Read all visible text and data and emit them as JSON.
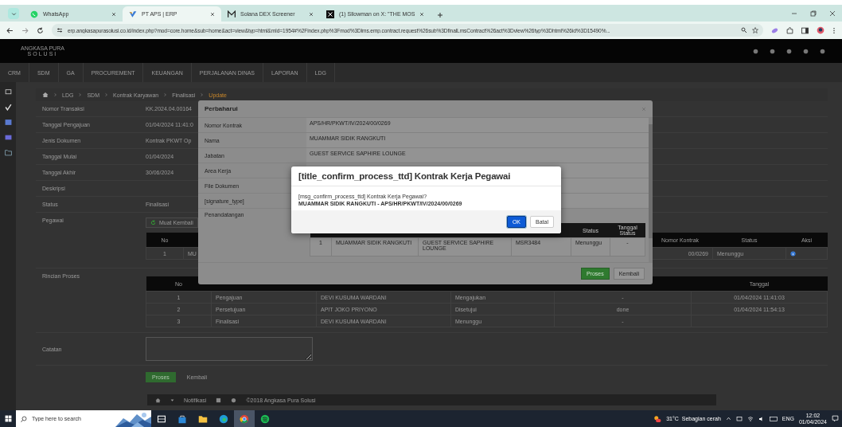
{
  "browser": {
    "tabs": [
      {
        "title": "WhatsApp",
        "kind": "whatsapp",
        "selected": false
      },
      {
        "title": "PT APS | ERP",
        "kind": "erp",
        "selected": true
      },
      {
        "title": "Solana DEX Screener",
        "kind": "m",
        "selected": false
      },
      {
        "title": "(1) Sllowman on X: \"THE MOS",
        "kind": "x",
        "selected": false
      }
    ],
    "url": "erp.angkasapurasolusi.co.id/index.php?mod=core.home&sub=home&act=view&typ=html&mId=1954#%2Findex.php%3Fmod%3Dlms.emp.contract.request%26sub%3DfinalLmsContract%26act%3Dview%26typ%3Dhtml%26id%3D15490%..."
  },
  "app": {
    "logo": {
      "name": "ANGKASA PURA",
      "sub": "SOLUSI"
    },
    "nav": [
      "CRM",
      "SDM",
      "GA",
      "PROCUREMENT",
      "KEUANGAN",
      "PERJALANAN DINAS",
      "LAPORAN",
      "LDG"
    ],
    "breadcrumb": [
      "LDG",
      "SDM",
      "Kontrak Karyawan",
      "Finalisasi",
      "Update"
    ],
    "form": [
      {
        "label": "Nomor Transaksi",
        "value": "KK.2024.04.00164"
      },
      {
        "label": "Tanggal Pengajuan",
        "value": "01/04/2024 11:41:0"
      },
      {
        "label": "Jenis Dokumen",
        "value": "Kontrak PKWT Op"
      },
      {
        "label": "Tanggal Mulai",
        "value": "01/04/2024"
      },
      {
        "label": "Tanggal Akhir",
        "value": "30/06/2024"
      },
      {
        "label": "Deskripsi"
      },
      {
        "label": "Status",
        "value": "Finalisasi"
      }
    ],
    "pegawai": {
      "label": "Pegawai",
      "reload_button": "Muat Kembali",
      "columns": [
        "No",
        "Nomor Kontrak",
        "Status",
        "Aksi"
      ],
      "row": {
        "no": "1",
        "name": "MU",
        "contract": "00/0269",
        "status": "Menunggu"
      }
    },
    "rincian": {
      "label": "Rincian Proses",
      "columns": [
        "No",
        "",
        "",
        "",
        "",
        "Tanggal"
      ],
      "rows": [
        [
          "1",
          "Pengajuan",
          "DEVI KUSUMA WARDANI",
          "Mengajukan",
          "-",
          "01/04/2024 11:41:03"
        ],
        [
          "2",
          "Persetujuan",
          "APIT JOKO PRIYONO",
          "Disetujui",
          "done",
          "01/04/2024 11:54:13"
        ],
        [
          "3",
          "Finalisasi",
          "DEVI KUSUMA WARDANI",
          "Menunggu",
          "-",
          ""
        ]
      ]
    },
    "catatan": {
      "label": "Catatan"
    },
    "buttons": [
      {
        "label": "Proses",
        "kind": "primary"
      },
      {
        "label": "Kembali",
        "kind": "link"
      }
    ],
    "footer": {
      "notification": "Notifikasi",
      "copyright": "©2018 Angkasa Pura Solusi"
    }
  },
  "modal": {
    "title": "Perbaharui",
    "fields": [
      {
        "label": "Nomor Kontrak",
        "value": "APS/HR/PKWT/IV/2024/00/0269"
      },
      {
        "label": "Nama",
        "value": "MUAMMAR SIDIK RANGKUTI"
      },
      {
        "label": "Jabatan",
        "value": "GUEST SERVICE SAPHIRE LOUNGE"
      },
      {
        "label": "Area Kerja"
      },
      {
        "label": "File Dokumen"
      },
      {
        "label": "[signature_type]"
      },
      {
        "label": "Penandatangan"
      }
    ],
    "signers": {
      "columns": [
        "",
        "",
        "",
        "",
        "Status",
        "Tanggal Status"
      ],
      "rows": [
        [
          "1",
          "MUAMMAR SIDIK RANGKUTI",
          "GUEST SERVICE SAPHIRE LOUNGE",
          "MSR3484",
          "Menunggu",
          "-"
        ]
      ]
    },
    "buttons": [
      {
        "label": "Proses",
        "kind": "primary"
      },
      {
        "label": "Kembali",
        "kind": "default"
      }
    ]
  },
  "confirm": {
    "title": "[title_confirm_process_ttd] Kontrak Kerja Pegawai",
    "message": "[msg_confirm_process_ttd] Kontrak Kerja Pegawai?",
    "detail": "MUAMMAR SIDIK RANGKUTI - APS/HR/PKWT/IV/2024/00/0269",
    "buttons": [
      {
        "label": "OK",
        "kind": "primary"
      },
      {
        "label": "Batal",
        "kind": "default"
      }
    ]
  },
  "taskbar": {
    "search_placeholder": "Type here to search",
    "apps": [
      {
        "kind": "taskview",
        "selected": false
      },
      {
        "kind": "store",
        "selected": false
      },
      {
        "kind": "explorer",
        "selected": false
      },
      {
        "kind": "edge",
        "selected": false
      },
      {
        "kind": "chrome",
        "selected": true
      },
      {
        "kind": "spotify",
        "selected": false
      }
    ],
    "weather": "31°C  Sebagian cerah",
    "language": "ENG",
    "time": "12:02",
    "date": "01/04/2024"
  }
}
